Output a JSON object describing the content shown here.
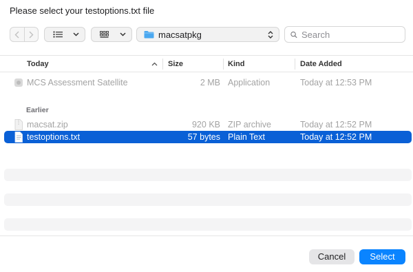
{
  "dialog": {
    "title": "Please select your testoptions.txt file"
  },
  "toolbar": {
    "back_icon": "chevron-left-icon",
    "forward_icon": "chevron-right-icon",
    "list_view_icon": "list-view-icon",
    "grid_view_icon": "grid-view-icon",
    "location": "macsatpkg",
    "location_icon": "folder-icon",
    "search_placeholder": "Search"
  },
  "columns": {
    "name": "Today",
    "size": "Size",
    "kind": "Kind",
    "date_added": "Date Added"
  },
  "groups": [
    {
      "label": "Today",
      "files": [
        {
          "name": "MCS Assessment Satellite",
          "size": "2 MB",
          "kind": "Application",
          "date": "Today at 12:53 PM",
          "enabled": false,
          "selected": false
        }
      ]
    },
    {
      "label": "Earlier",
      "files": [
        {
          "name": "macsat.zip",
          "size": "920 KB",
          "kind": "ZIP archive",
          "date": "Today at 12:52 PM",
          "enabled": false,
          "selected": false
        },
        {
          "name": "testoptions.txt",
          "size": "57 bytes",
          "kind": "Plain Text",
          "date": "Today at 12:52 PM",
          "enabled": true,
          "selected": true
        }
      ]
    }
  ],
  "buttons": {
    "cancel": "Cancel",
    "select": "Select"
  },
  "colors": {
    "selection": "#0a60d6",
    "primary_button": "#0a84ff",
    "folder": "#4aa8f0"
  }
}
